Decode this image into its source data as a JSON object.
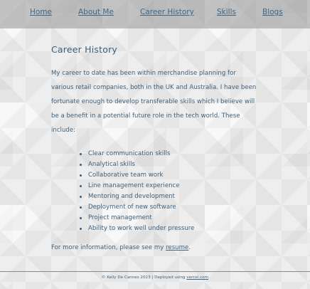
{
  "nav": {
    "home": "Home",
    "about": "About Me",
    "career": "Career History",
    "skills": "Skills",
    "blogs": "Blogs"
  },
  "main": {
    "title": "Career History",
    "intro": "My career to date has been within merchandise planning for various retail companies, both in the UK and Australia. I have been fortunate enough to develop transferable skills which I believe will be a benefit in a potential future role in the tech world. These include:",
    "skills": [
      "Clear communication skills",
      "Analytical skills",
      "Collaborative team work",
      "Line management experience",
      "Mentoring and development",
      "Deployment of new software",
      "Project management",
      "Ability to work well under pressure"
    ],
    "more_info_prefix": "For more information, please see my ",
    "resume_link": "resume",
    "more_info_suffix": "."
  },
  "footer": {
    "copyright": "© Kelly De Cannes 2023 | Deployed using ",
    "vercel_link": "vercel.com"
  },
  "colors": {
    "text": "#3e5f7a",
    "link": "#3e6786",
    "navbar": "#9a9a9a",
    "background": "#eeeeee"
  }
}
